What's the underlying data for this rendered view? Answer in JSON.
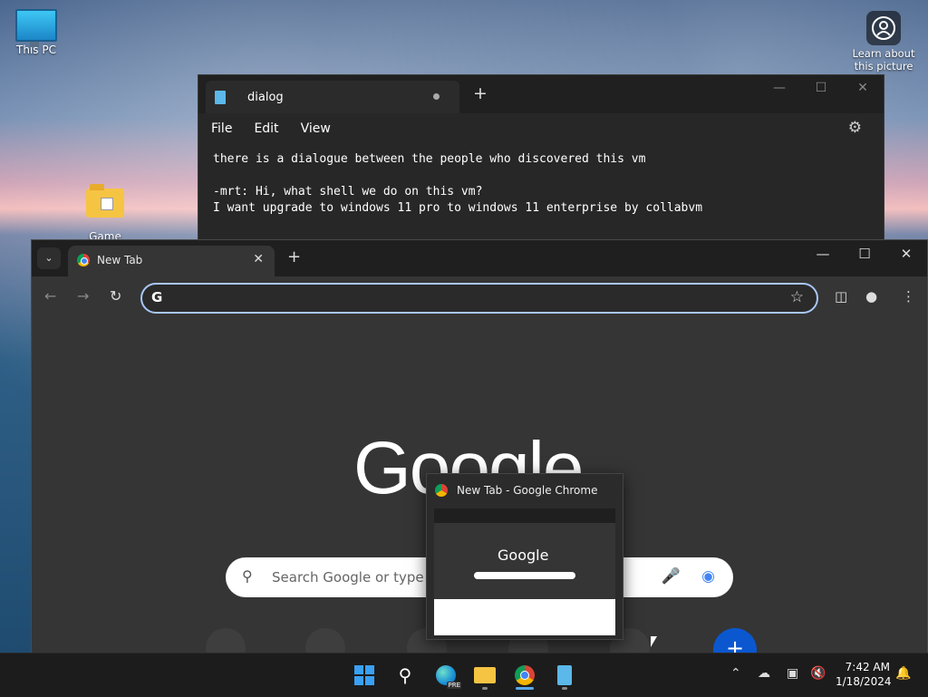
{
  "desktop": {
    "icons": [
      {
        "label": "This PC"
      },
      {
        "label": "Game master"
      },
      {
        "label": "Learn about this picture"
      }
    ]
  },
  "notepad": {
    "tab_title": "dialog",
    "new_tab": "+",
    "menu": [
      "File",
      "Edit",
      "View"
    ],
    "lines": [
      "there is a dialogue between the people who discovered this vm",
      "",
      "-mrt: Hi, what shell we do on this vm?",
      "I want upgrade to windows 11 pro to windows 11 enterprise by collabvm"
    ]
  },
  "chrome": {
    "tab_title": "New Tab",
    "omnibox_value": "",
    "logo": "Google",
    "search_placeholder": "Search Google or type a URL",
    "add_shortcut": "+"
  },
  "preview": {
    "title": "New Tab - Google Chrome",
    "thumb_logo": "Google"
  },
  "taskbar": {
    "apps": [
      "start",
      "search",
      "edge-preview",
      "file-explorer",
      "chrome",
      "notepad"
    ],
    "edge_badge": "PRE",
    "time": "7:42 AM",
    "date": "1/18/2024"
  }
}
